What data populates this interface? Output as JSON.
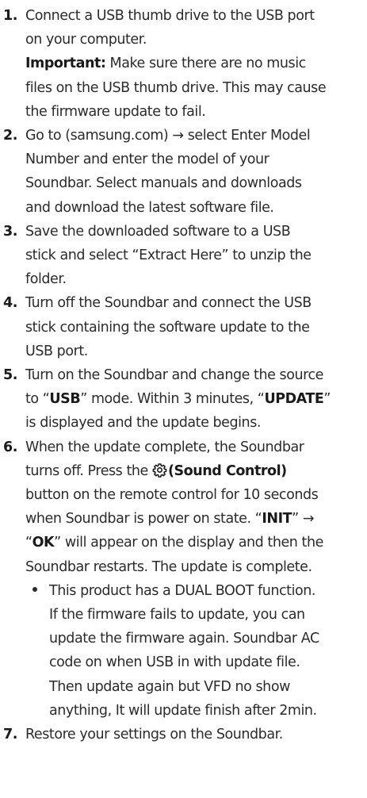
{
  "steps": [
    {
      "number": "1.",
      "lines": [
        "Connect a USB thumb drive to the USB port",
        "on your computer."
      ],
      "note": {
        "label": "Important:",
        "first_rest": " Make sure there are no music",
        "lines": [
          "files on the USB thumb drive. This may cause",
          "the firmware update to fail."
        ]
      }
    },
    {
      "number": "2.",
      "lines": [
        "Go to (samsung.com) → select Enter Model",
        "Number and enter the model of your",
        "Soundbar. Select manuals and downloads",
        "and download the latest software file."
      ]
    },
    {
      "number": "3.",
      "lines": [
        "Save the downloaded software to a USB",
        "stick and select “Extract Here” to unzip the",
        "folder."
      ]
    },
    {
      "number": "4.",
      "lines": [
        "Turn off the Soundbar and connect the USB",
        "stick containing the software update to the",
        "USB port."
      ]
    },
    {
      "number": "5.",
      "line1": "Turn on the Soundbar and change the source",
      "line2_a": "to “",
      "line2_b": "USB",
      "line2_c": "” mode. Within 3 minutes, “",
      "line2_d": "UPDATE",
      "line2_e": "”",
      "line3": "is displayed and the update begins."
    },
    {
      "number": "6.",
      "line1": "When the update complete, the Soundbar",
      "line2_a": "turns off. Press the ",
      "line2_b": "(Sound Control)",
      "line3": "button on the remote control for 10 seconds",
      "line4_a": "when Soundbar is power on state. “",
      "line4_b": "INIT",
      "line4_c": "” →",
      "line5_a": "“",
      "line5_b": "OK",
      "line5_c": "” will appear on the display and then the",
      "line6": "Soundbar restarts. The update is complete.",
      "bullet_lines": [
        "This product has a DUAL BOOT function.",
        "If the firmware fails to update, you can",
        "update the firmware again. Soundbar AC",
        "code on when USB in with update file.",
        "Then update again but VFD no show",
        "anything, It will update finish after 2min."
      ]
    },
    {
      "number": "7.",
      "lines": [
        "Restore your settings on the Soundbar."
      ]
    }
  ],
  "icons": {
    "sound_control": "gear-icon"
  }
}
